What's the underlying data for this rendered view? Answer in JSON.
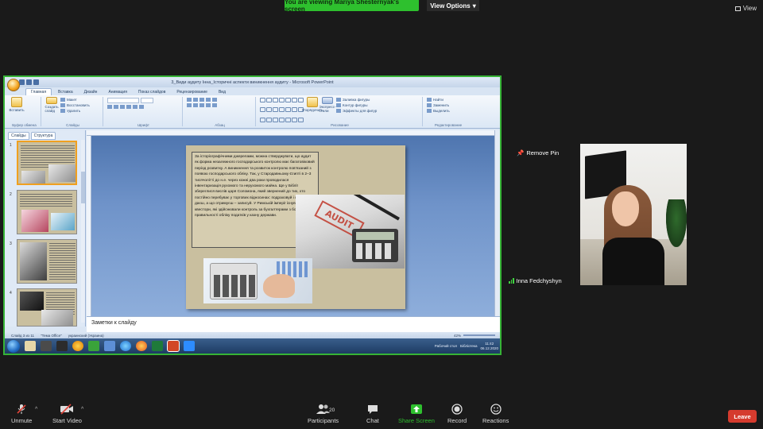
{
  "zoom": {
    "share_banner": "You are viewing Mariya Shesternyak's screen",
    "view_options": "View Options",
    "view_button": "View",
    "remove_pin": "Remove Pin",
    "participant_name": "Inna Fedchyshyn",
    "participants_count": "20",
    "controls": {
      "unmute": "Unmute",
      "start_video": "Start Video",
      "participants": "Participants",
      "chat": "Chat",
      "share_screen": "Share Screen",
      "record": "Record",
      "reactions": "Reactions",
      "leave": "Leave"
    },
    "colors": {
      "share_green": "#2ec02e",
      "leave_red": "#d53b2e"
    }
  },
  "ppt": {
    "window_title": "3_Види аудиту Інна_Історичні аспекти виникнення аудиту - Microsoft PowerPoint",
    "tabs": [
      "Главная",
      "Вставка",
      "Дизайн",
      "Анимация",
      "Показ слайдов",
      "Рецензирование",
      "Вид"
    ],
    "ribbon": {
      "paste": "Вставить",
      "clipboard": "Буфер обмена",
      "layout": "Макет",
      "reset": "Восстановить",
      "create_slide": "Создать слайд",
      "delete": "Удалить",
      "slides_group": "Слайды",
      "font_group": "Шрифт",
      "paragraph_group": "Абзац",
      "arrange": "Упорядочить",
      "quick_styles": "Экспресс-стили",
      "drawing_group": "Рисование",
      "shape_fill": "Заливка фигуры",
      "shape_outline": "Контур фигуры",
      "shape_effects": "Эффекты для фигур",
      "find": "Найти",
      "replace": "Заменить",
      "select": "Выделить",
      "editing_group": "Редактирование"
    },
    "panel_tabs": [
      "Слайды",
      "Структура"
    ],
    "thumb_numbers": [
      "1",
      "2",
      "3",
      "4"
    ],
    "slide_text": "За історіографічними джерелами, можна стверджувати, що аудит як форма незалежного господарського контролю має багатовіковий період розвитку. А виникнення та розвиток контролю пов'язаний з появою господарського обліку. Так, у Стародавньому Єгипті в 2–3 тисячолітті до н.е. через кожні два роки проводилася інвентаризація рухомого та нерухомого майна. Ще у Біблії збереглися вислів царя Соломона, який звернений до тих, хто постійно перебуває у торгових відносинах: подраховуй і оцінюй, що даєш, а що отримуєш – записуй. У Римській імперії існували квестори, які здійснювали контроль за бухгалтерами з боку правильності обліку податків у казну держави.",
    "audit_stamp": "AUDIT",
    "notes_placeholder": "Заметки к слайду",
    "status": {
      "slide_pos": "Слайд 3 из 11",
      "theme": "\"Тема Office\"",
      "language": "украинский (Украина)",
      "zoom": "42%"
    },
    "tray": {
      "desktop": "Рабочий стол",
      "library": "Бібліотека",
      "time": "11:42",
      "date": "06.12.2020"
    }
  }
}
